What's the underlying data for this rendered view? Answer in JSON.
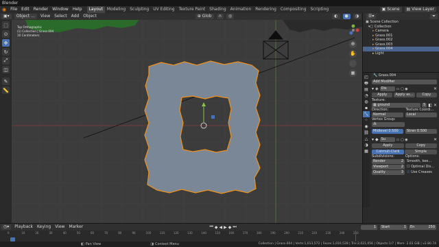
{
  "window_title": "Blender",
  "menu": [
    "File",
    "Edit",
    "Render",
    "Window",
    "Help"
  ],
  "workspaces": [
    "Layout",
    "Modeling",
    "Sculpting",
    "UV Editing",
    "Texture Paint",
    "Shading",
    "Animation",
    "Rendering",
    "Compositing",
    "Scripting"
  ],
  "active_workspace": "Layout",
  "topbar_right": {
    "scene": "Scene",
    "view_layer": "View Layer"
  },
  "header": {
    "orientation_label": "Orientation:",
    "orientation_value": "Default",
    "drag_label": "Drag:",
    "drag_value": "Select Box",
    "mode": "Object ...",
    "menus": [
      "View",
      "Select",
      "Add",
      "Object"
    ],
    "transform": "Glob",
    "options": "Options"
  },
  "viewport": {
    "info_lines": [
      "Top Orthographic",
      "(1) Collection | Grass.004",
      "10 Centimeters"
    ]
  },
  "outliner": {
    "root": "Scene Collection",
    "collection": "Collection",
    "items": [
      {
        "name": "Camera",
        "selected": false
      },
      {
        "name": "Grass.001",
        "selected": false
      },
      {
        "name": "Grass.002",
        "selected": false
      },
      {
        "name": "Grass.003",
        "selected": false
      },
      {
        "name": "Grass.004",
        "selected": true
      },
      {
        "name": "Light",
        "selected": false
      }
    ]
  },
  "properties": {
    "object_name": "Grass.004",
    "add_modifier": "Add Modifier",
    "displace": {
      "name": "Dis",
      "apply": "Apply",
      "apply_as": "Apply as...",
      "copy": "Copy",
      "texture_label": "Texture:",
      "texture_value": "ground",
      "texture_users": "5",
      "direction_label": "Direction:",
      "direction_value": "Normal",
      "coordinates_label": "Texture Coordi...",
      "coordinates_value": "Local",
      "vertex_group_label": "Vertex Group:",
      "midlevel_label": "Midlevel",
      "midlevel_value": "0.500",
      "strength_label": "Stren",
      "strength_value": "0.500"
    },
    "subsurf": {
      "name": "Su",
      "apply": "Apply",
      "copy": "Copy",
      "catmull": "Catmull-Clark",
      "simple": "Simple",
      "subdivisions_label": "Subdivisions:",
      "options_label": "Options:",
      "render_label": "Render",
      "render_value": "2",
      "viewport_label": "Viewport",
      "viewport_value": "2",
      "quality_label": "Quality",
      "quality_value": "3",
      "opt1": "Smooth, kee...",
      "opt2": "Optimal Dis...",
      "opt3": "Use Creases"
    }
  },
  "timeline": {
    "menus": [
      "Playback",
      "Keying",
      "View",
      "Marker"
    ],
    "current_frame": "1",
    "start_label": "Start",
    "start_value": "1",
    "end_label": "En",
    "end_value": "250",
    "ticks": [
      "0",
      "10",
      "20",
      "30",
      "40",
      "50",
      "60",
      "70",
      "80",
      "90",
      "100",
      "110",
      "120",
      "130",
      "140",
      "150",
      "160",
      "170",
      "180",
      "190",
      "200",
      "210",
      "220",
      "230",
      "240",
      "250"
    ]
  },
  "status": {
    "left": "Pan View",
    "middle": "Context Menu",
    "right": "Collection | Grass.004 | Verts:1,013,572 | Faces:1,010,528 | Tris:2,021,056 | Objects:1/7 | Mem: 2.03 GiB | v2.80.74"
  },
  "colors": {
    "accent": "#4772b3",
    "selection_outline": "#f0921b",
    "mesh": "#7a8797",
    "viewport_bg": "#3c3c3c"
  }
}
